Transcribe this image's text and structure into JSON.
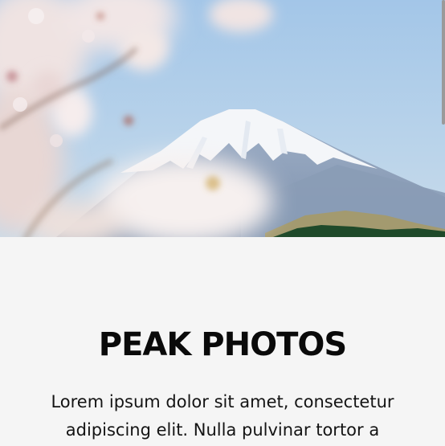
{
  "hero": {
    "image_name": "mountain-with-cherry-blossoms"
  },
  "section": {
    "title": "PEAK PHOTOS",
    "body": "Lorem ipsum dolor sit amet, consectetur adipiscing elit. Nulla pulvinar tortor a"
  },
  "colors": {
    "background": "#f5f5f5",
    "title": "#0a0a0a",
    "body_text": "#141414",
    "sky": "#a9c9e6",
    "snow": "#f4f6f9"
  }
}
